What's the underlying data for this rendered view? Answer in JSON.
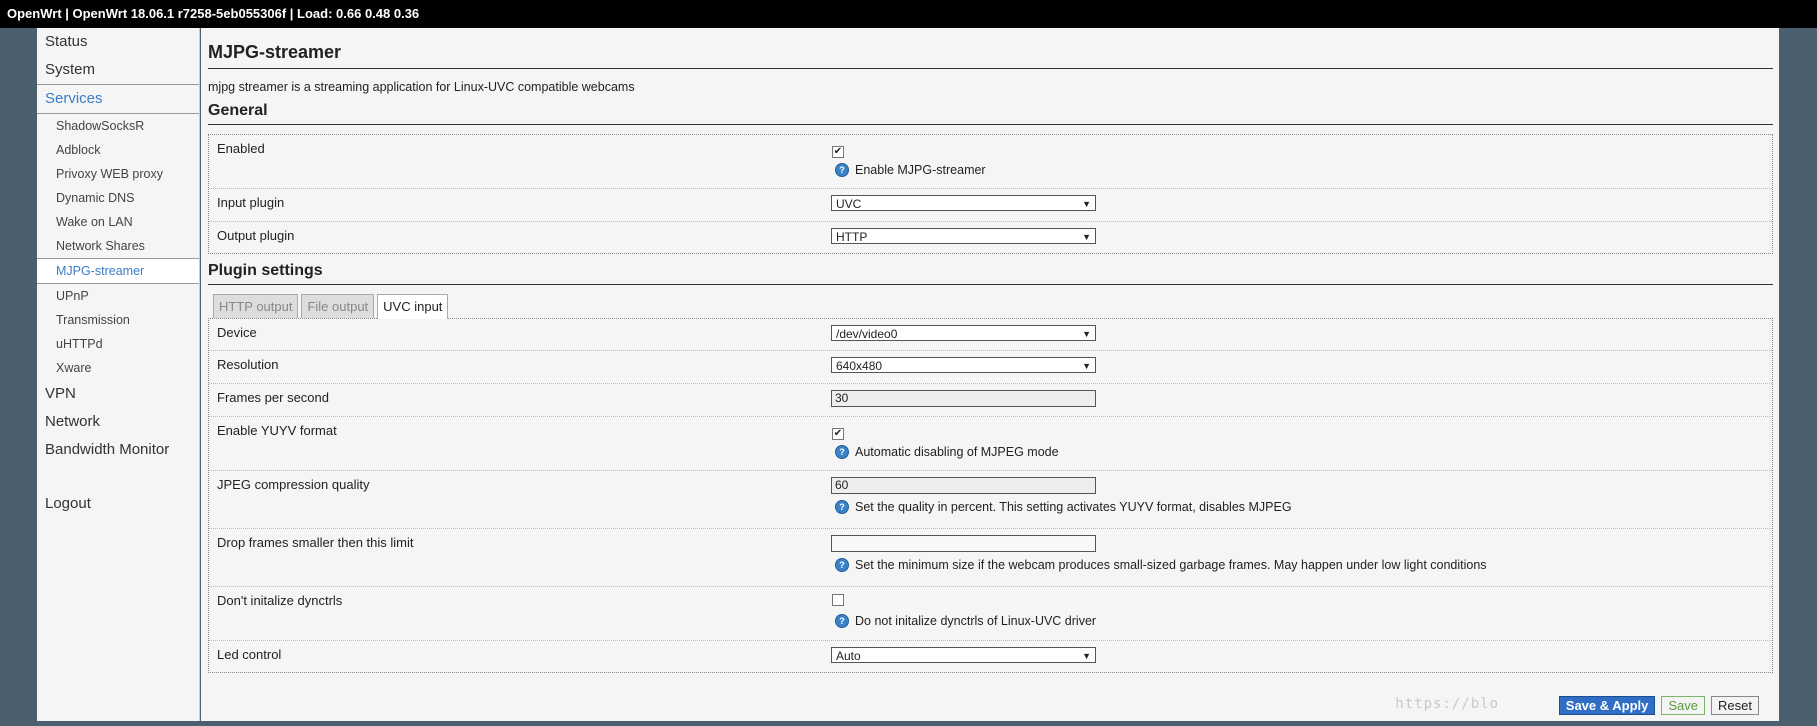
{
  "topbar": {
    "text": "OpenWrt | OpenWrt 18.06.1 r7258-5eb055306f | Load: 0.66 0.48 0.36"
  },
  "sidebar": {
    "top_items": [
      "Status",
      "System",
      "Services"
    ],
    "sub_items": [
      "ShadowSocksR",
      "Adblock",
      "Privoxy WEB proxy",
      "Dynamic DNS",
      "Wake on LAN",
      "Network Shares",
      "MJPG-streamer",
      "UPnP",
      "Transmission",
      "uHTTPd",
      "Xware"
    ],
    "bottom_items": [
      "VPN",
      "Network",
      "Bandwidth Monitor"
    ],
    "logout": "Logout"
  },
  "page": {
    "title": "MJPG-streamer",
    "description": "mjpg streamer is a streaming application for Linux-UVC compatible webcams"
  },
  "general": {
    "title": "General",
    "enabled_label": "Enabled",
    "enabled_help": "Enable MJPG-streamer",
    "input_label": "Input plugin",
    "input_value": "UVC",
    "output_label": "Output plugin",
    "output_value": "HTTP"
  },
  "plugin": {
    "title": "Plugin settings",
    "tabs": [
      "HTTP output",
      "File output",
      "UVC input"
    ],
    "device_label": "Device",
    "device_value": "/dev/video0",
    "resolution_label": "Resolution",
    "resolution_value": "640x480",
    "fps_label": "Frames per second",
    "fps_value": "30",
    "yuyv_label": "Enable YUYV format",
    "yuyv_help": "Automatic disabling of MJPEG mode",
    "jpeg_label": "JPEG compression quality",
    "jpeg_value": "60",
    "jpeg_help": "Set the quality in percent. This setting activates YUYV format, disables MJPEG",
    "drop_label": "Drop frames smaller then this limit",
    "drop_value": "",
    "drop_help": "Set the minimum size if the webcam produces small-sized garbage frames. May happen under low light conditions",
    "dync_label": "Don't initalize dynctrls",
    "dync_help": "Do not initalize dynctrls of Linux-UVC driver",
    "led_label": "Led control",
    "led_value": "Auto"
  },
  "buttons": {
    "save_apply": "Save & Apply",
    "save": "Save",
    "reset": "Reset"
  },
  "watermark": "https://blo"
}
